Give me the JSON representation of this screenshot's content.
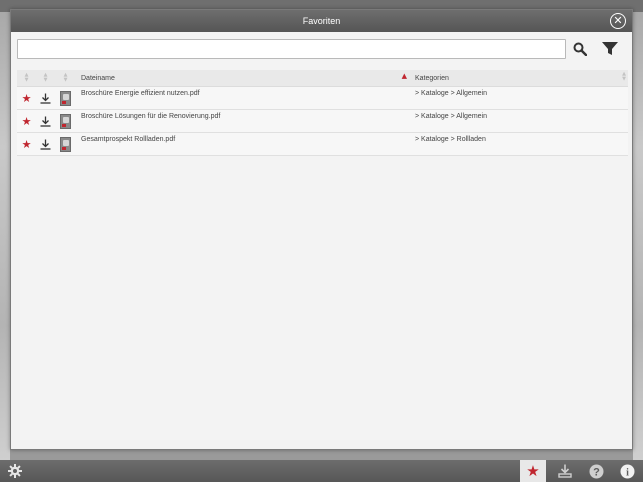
{
  "modal": {
    "title": "Favoriten",
    "search": {
      "value": "",
      "placeholder": ""
    }
  },
  "table": {
    "headers": {
      "name": "Dateiname",
      "category": "Kategorien"
    },
    "rows": [
      {
        "favorite": true,
        "name": "Broschüre Energie effizient nutzen.pdf",
        "category": "> Kataloge > Allgemein"
      },
      {
        "favorite": true,
        "name": "Broschüre Lösungen für die Renovierung.pdf",
        "category": "> Kataloge > Allgemein"
      },
      {
        "favorite": true,
        "name": "Gesamtprospekt Rollladen.pdf",
        "category": "> Kataloge > Rollladen"
      }
    ]
  },
  "icons": {
    "close": "close-icon",
    "search": "search-icon",
    "filter": "filter-icon",
    "star": "star-icon",
    "download": "download-icon",
    "settings": "gear-icon",
    "help": "question-icon",
    "info": "info-icon"
  },
  "colors": {
    "accent": "#c0262f",
    "header": "#5f5f5f",
    "panel": "#f3f3f3"
  }
}
